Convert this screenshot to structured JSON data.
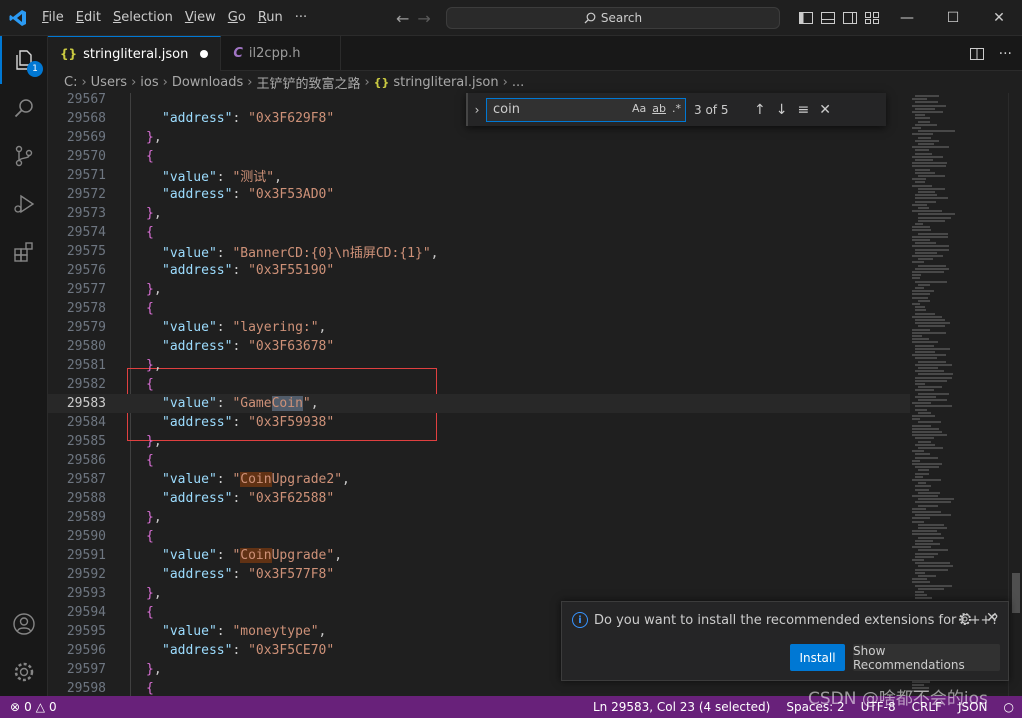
{
  "menu": {
    "items": [
      "File",
      "Edit",
      "Selection",
      "View",
      "Go",
      "Run",
      "···"
    ]
  },
  "search": {
    "label": "Search"
  },
  "explorer_badge": "1",
  "tabs": [
    {
      "label": "stringliteral.json",
      "icon": "json-braces-icon",
      "active": true,
      "dirty": true
    },
    {
      "label": "il2cpp.h",
      "icon": "c-file-icon",
      "active": false,
      "dirty": false
    }
  ],
  "breadcrumb": {
    "parts": [
      "C:",
      "Users",
      "ios",
      "Downloads",
      "王铲铲的致富之路",
      "stringliteral.json",
      "..."
    ]
  },
  "editor": {
    "lines": [
      {
        "n": "29567",
        "parts": []
      },
      {
        "n": "29568",
        "parts": [
          [
            "k",
            "\"address\""
          ],
          [
            "p",
            ": "
          ],
          [
            "s",
            "\"0x3F629F8\""
          ]
        ]
      },
      {
        "n": "29569",
        "parts": [
          [
            "br",
            "}"
          ],
          [
            "p",
            ","
          ]
        ]
      },
      {
        "n": "29570",
        "parts": [
          [
            "br",
            "{"
          ]
        ]
      },
      {
        "n": "29571",
        "parts": [
          [
            "k",
            "\"value\""
          ],
          [
            "p",
            ": "
          ],
          [
            "s",
            "\"测试\""
          ],
          [
            "p",
            ","
          ]
        ]
      },
      {
        "n": "29572",
        "parts": [
          [
            "k",
            "\"address\""
          ],
          [
            "p",
            ": "
          ],
          [
            "s",
            "\"0x3F53AD0\""
          ]
        ]
      },
      {
        "n": "29573",
        "parts": [
          [
            "br",
            "}"
          ],
          [
            "p",
            ","
          ]
        ]
      },
      {
        "n": "29574",
        "parts": [
          [
            "br",
            "{"
          ]
        ]
      },
      {
        "n": "29575",
        "parts": [
          [
            "k",
            "\"value\""
          ],
          [
            "p",
            ": "
          ],
          [
            "s",
            "\"BannerCD:{0}\\n插屏CD:{1}\""
          ],
          [
            "p",
            ","
          ]
        ]
      },
      {
        "n": "29576",
        "parts": [
          [
            "k",
            "\"address\""
          ],
          [
            "p",
            ": "
          ],
          [
            "s",
            "\"0x3F55190\""
          ]
        ]
      },
      {
        "n": "29577",
        "parts": [
          [
            "br",
            "}"
          ],
          [
            "p",
            ","
          ]
        ]
      },
      {
        "n": "29578",
        "parts": [
          [
            "br",
            "{"
          ]
        ]
      },
      {
        "n": "29579",
        "parts": [
          [
            "k",
            "\"value\""
          ],
          [
            "p",
            ": "
          ],
          [
            "s",
            "\"layering:\""
          ],
          [
            "p",
            ","
          ]
        ]
      },
      {
        "n": "29580",
        "parts": [
          [
            "k",
            "\"address\""
          ],
          [
            "p",
            ": "
          ],
          [
            "s",
            "\"0x3F63678\""
          ]
        ]
      },
      {
        "n": "29581",
        "parts": [
          [
            "br",
            "}"
          ],
          [
            "p",
            ","
          ]
        ]
      },
      {
        "n": "29582",
        "parts": [
          [
            "br",
            "{"
          ]
        ]
      },
      {
        "n": "29583",
        "parts": [
          [
            "k",
            "\"value\""
          ],
          [
            "p",
            ": "
          ],
          [
            "s",
            "\"Game"
          ],
          [
            "s hl-cur",
            "Coin"
          ],
          [
            "s",
            "\""
          ],
          [
            "p",
            ","
          ]
        ],
        "current": true
      },
      {
        "n": "29584",
        "parts": [
          [
            "k",
            "\"address\""
          ],
          [
            "p",
            ": "
          ],
          [
            "s",
            "\"0x3F59938\""
          ]
        ]
      },
      {
        "n": "29585",
        "parts": [
          [
            "br",
            "}"
          ],
          [
            "p",
            ","
          ]
        ]
      },
      {
        "n": "29586",
        "parts": [
          [
            "br",
            "{"
          ]
        ]
      },
      {
        "n": "29587",
        "parts": [
          [
            "k",
            "\"value\""
          ],
          [
            "p",
            ": "
          ],
          [
            "s",
            "\""
          ],
          [
            "s hl",
            "Coin"
          ],
          [
            "s",
            "Upgrade2\""
          ],
          [
            "p",
            ","
          ]
        ]
      },
      {
        "n": "29588",
        "parts": [
          [
            "k",
            "\"address\""
          ],
          [
            "p",
            ": "
          ],
          [
            "s",
            "\"0x3F62588\""
          ]
        ]
      },
      {
        "n": "29589",
        "parts": [
          [
            "br",
            "}"
          ],
          [
            "p",
            ","
          ]
        ]
      },
      {
        "n": "29590",
        "parts": [
          [
            "br",
            "{"
          ]
        ]
      },
      {
        "n": "29591",
        "parts": [
          [
            "k",
            "\"value\""
          ],
          [
            "p",
            ": "
          ],
          [
            "s",
            "\""
          ],
          [
            "s hl",
            "Coin"
          ],
          [
            "s",
            "Upgrade\""
          ],
          [
            "p",
            ","
          ]
        ]
      },
      {
        "n": "29592",
        "parts": [
          [
            "k",
            "\"address\""
          ],
          [
            "p",
            ": "
          ],
          [
            "s",
            "\"0x3F577F8\""
          ]
        ]
      },
      {
        "n": "29593",
        "parts": [
          [
            "br",
            "}"
          ],
          [
            "p",
            ","
          ]
        ]
      },
      {
        "n": "29594",
        "parts": [
          [
            "br",
            "{"
          ]
        ]
      },
      {
        "n": "29595",
        "parts": [
          [
            "k",
            "\"value\""
          ],
          [
            "p",
            ": "
          ],
          [
            "s",
            "\"moneytype\""
          ],
          [
            "p",
            ","
          ]
        ]
      },
      {
        "n": "29596",
        "parts": [
          [
            "k",
            "\"address\""
          ],
          [
            "p",
            ": "
          ],
          [
            "s",
            "\"0x3F5CE70\""
          ]
        ]
      },
      {
        "n": "29597",
        "parts": [
          [
            "br",
            "}"
          ],
          [
            "p",
            ","
          ]
        ]
      },
      {
        "n": "29598",
        "parts": [
          [
            "br",
            "{"
          ]
        ]
      }
    ]
  },
  "find": {
    "query": "coin",
    "match_case_label": "Aa",
    "whole_word_label": "ab",
    "regex_label": ".*",
    "count": "3 of 5"
  },
  "notification": {
    "message": "Do you want to install the recommended extensions for C++?",
    "install_label": "Install",
    "recommendations_label": "Show Recommendations"
  },
  "statusbar": {
    "errors": "0",
    "warnings": "0",
    "position": "Ln 29583, Col 23 (4 selected)",
    "spaces": "Spaces: 2",
    "encoding": "UTF-8",
    "eol": "CRLF",
    "language": "JSON"
  },
  "watermark": "CSDN @啥都不会的ios",
  "colors": {
    "accent": "#0078d4",
    "statusbar": "#68217a",
    "match_highlight": "#613214",
    "current_match": "#515c6a",
    "selection_box": "#e04040"
  }
}
